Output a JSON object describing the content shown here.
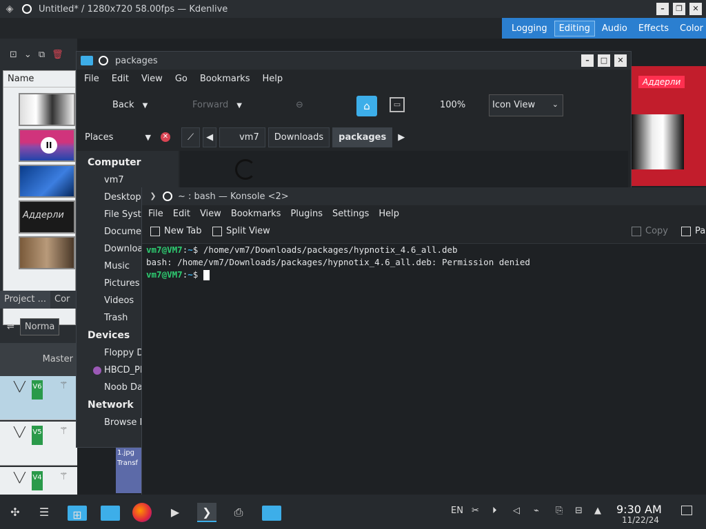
{
  "kdenlive": {
    "title": "Untitled* / 1280x720 58.00fps — Kdenlive",
    "workspaces": [
      "Logging",
      "Editing",
      "Audio",
      "Effects",
      "Color"
    ],
    "active_workspace": "Editing",
    "bin_header": "Name",
    "thumb_label": "Аддерли",
    "preview_label": "Аддерли",
    "tabs": [
      "Project ...",
      "Cor"
    ],
    "mode": "Norma",
    "master": "Master",
    "tracks": [
      "V6",
      "V5",
      "V4"
    ],
    "clip_label": "1.jpg",
    "clip_sub": "Transf"
  },
  "dolphin": {
    "title": "packages",
    "menu": [
      "File",
      "Edit",
      "View",
      "Go",
      "Bookmarks",
      "Help"
    ],
    "back": "Back",
    "forward": "Forward",
    "zoom": "100%",
    "view_mode": "Icon View",
    "places_label": "Places",
    "breadcrumb": [
      "vm7",
      "Downloads",
      "packages"
    ],
    "sections": {
      "computer": "Computer",
      "devices": "Devices",
      "network": "Network"
    },
    "computer_items": [
      "vm7",
      "Desktop",
      "File Syste",
      "Documer",
      "Downloa",
      "Music",
      "Pictures",
      "Videos",
      "Trash"
    ],
    "device_items": [
      "Floppy D",
      "HBCD_PE",
      "Noob Da"
    ],
    "network_items": [
      "Browse N"
    ]
  },
  "konsole": {
    "title": "~ : bash — Konsole <2>",
    "menu": [
      "File",
      "Edit",
      "View",
      "Bookmarks",
      "Plugins",
      "Settings",
      "Help"
    ],
    "new_tab": "New Tab",
    "split_view": "Split View",
    "copy": "Copy",
    "paste": "Pas",
    "prompt": "vm7@VM7",
    "prompt_path": "~",
    "cmd": "/home/vm7/Downloads/packages/hypnotix_4.6_all.deb",
    "error": "bash: /home/vm7/Downloads/packages/hypnotix_4.6_all.deb: Permission denied"
  },
  "taskbar": {
    "lang": "EN",
    "time": "9:30 AM",
    "date": "11/22/24"
  },
  "colors": {
    "accent": "#3daee9",
    "prompt": "#2ecc71",
    "workspace_bar": "#2b7fd0"
  }
}
